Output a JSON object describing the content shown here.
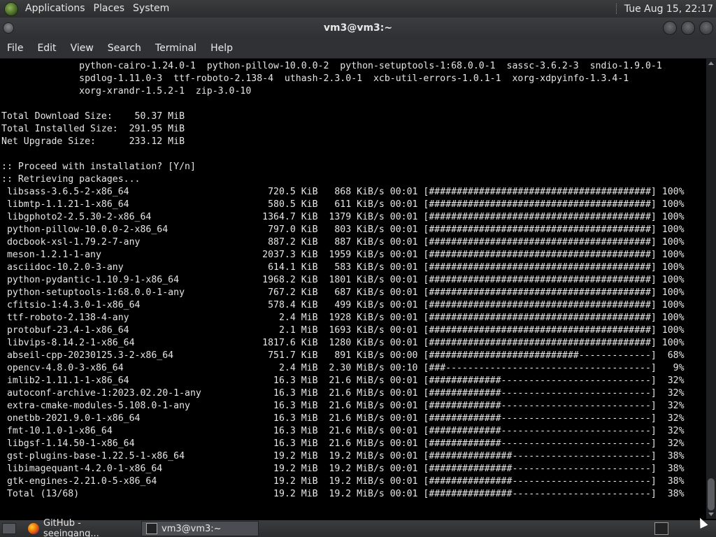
{
  "top_panel": {
    "menus": [
      "Applications",
      "Places",
      "System"
    ],
    "clock": "Tue Aug 15, 22:17"
  },
  "window": {
    "title": "vm3@vm3:~"
  },
  "menubar": [
    "File",
    "Edit",
    "View",
    "Search",
    "Terminal",
    "Help"
  ],
  "terminal_lines": [
    "              python-cairo-1.24.0-1  python-pillow-10.0.0-2  python-setuptools-1:68.0.0-1  sassc-3.6.2-3  sndio-1.9.0-1",
    "              spdlog-1.11.0-3  ttf-roboto-2.138-4  uthash-2.3.0-1  xcb-util-errors-1.0.1-1  xorg-xdpyinfo-1.3.4-1",
    "              xorg-xrandr-1.5.2-1  zip-3.0-10",
    "",
    "Total Download Size:    50.37 MiB",
    "Total Installed Size:  291.95 MiB",
    "Net Upgrade Size:      233.12 MiB",
    "",
    ":: Proceed with installation? [Y/n]",
    ":: Retrieving packages...",
    " libsass-3.6.5-2-x86_64                         720.5 KiB   868 KiB/s 00:01 [########################################] 100%",
    " libmtp-1.1.21-1-x86_64                         580.5 KiB   611 KiB/s 00:01 [########################################] 100%",
    " libgphoto2-2.5.30-2-x86_64                    1364.7 KiB  1379 KiB/s 00:01 [########################################] 100%",
    " python-pillow-10.0.0-2-x86_64                  797.0 KiB   803 KiB/s 00:01 [########################################] 100%",
    " docbook-xsl-1.79.2-7-any                       887.2 KiB   887 KiB/s 00:01 [########################################] 100%",
    " meson-1.2.1-1-any                             2037.3 KiB  1959 KiB/s 00:01 [########################################] 100%",
    " asciidoc-10.2.0-3-any                          614.1 KiB   583 KiB/s 00:01 [########################################] 100%",
    " python-pydantic-1.10.9-1-x86_64               1968.2 KiB  1801 KiB/s 00:01 [########################################] 100%",
    " python-setuptools-1:68.0.0-1-any               767.2 KiB   687 KiB/s 00:01 [########################################] 100%",
    " cfitsio-1:4.3.0-1-x86_64                       578.4 KiB   499 KiB/s 00:01 [########################################] 100%",
    " ttf-roboto-2.138-4-any                           2.4 MiB  1928 KiB/s 00:01 [########################################] 100%",
    " protobuf-23.4-1-x86_64                           2.1 MiB  1693 KiB/s 00:01 [########################################] 100%",
    " libvips-8.14.2-1-x86_64                       1817.6 KiB  1280 KiB/s 00:01 [########################################] 100%",
    " abseil-cpp-20230125.3-2-x86_64                 751.7 KiB   891 KiB/s 00:00 [###########################-------------]  68%",
    " opencv-4.8.0-3-x86_64                            2.4 MiB  2.30 MiB/s 00:10 [###-------------------------------------]   9%",
    " imlib2-1.11.1-1-x86_64                          16.3 MiB  21.6 MiB/s 00:01 [#############---------------------------]  32%",
    " autoconf-archive-1:2023.02.20-1-any             16.3 MiB  21.6 MiB/s 00:01 [#############---------------------------]  32%",
    " extra-cmake-modules-5.108.0-1-any               16.3 MiB  21.6 MiB/s 00:01 [#############---------------------------]  32%",
    " onetbb-2021.9.0-1-x86_64                        16.3 MiB  21.6 MiB/s 00:01 [#############---------------------------]  32%",
    " fmt-10.1.0-1-x86_64                             16.3 MiB  21.6 MiB/s 00:01 [#############---------------------------]  32%",
    " libgsf-1.14.50-1-x86_64                         16.3 MiB  21.6 MiB/s 00:01 [#############---------------------------]  32%",
    " gst-plugins-base-1.22.5-1-x86_64                19.2 MiB  19.2 MiB/s 00:01 [###############-------------------------]  38%",
    " libimagequant-4.2.0-1-x86_64                    19.2 MiB  19.2 MiB/s 00:01 [###############-------------------------]  38%",
    " gtk-engines-2.21.0-5-x86_64                     19.2 MiB  19.2 MiB/s 00:01 [###############-------------------------]  38%",
    " Total (13/68)                                   19.2 MiB  19.2 MiB/s 00:01 [###############-------------------------]  38%"
  ],
  "taskbar": {
    "tasks": [
      "GitHub - seeingang...",
      "vm3@vm3:~"
    ]
  },
  "icons": {
    "logo": "gnome-foot-icon",
    "firefox": "firefox-icon",
    "terminal": "terminal-icon"
  }
}
